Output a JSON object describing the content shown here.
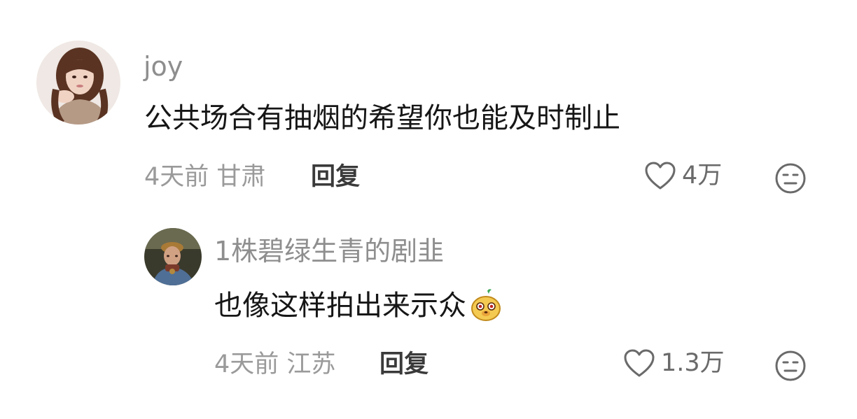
{
  "comments": [
    {
      "username": "joy",
      "text": "公共场合有抽烟的希望你也能及时制止",
      "time": "4天前",
      "location": "甘肃",
      "reply_label": "回复",
      "likes": "4万",
      "avatar_icon": "woman-portrait-avatar"
    }
  ],
  "replies": [
    {
      "username": "1株碧绿生青的剧韭",
      "text": "也像这样拍出来示众",
      "sticker_icon": "yellow-dog-emoji-sticker",
      "time": "4天前",
      "location": "江苏",
      "reply_label": "回复",
      "likes": "1.3万",
      "avatar_icon": "painting-portrait-avatar"
    }
  ],
  "icons": {
    "like": "heart-outline-icon",
    "dislike": "neutral-face-icon"
  },
  "colors": {
    "username": "#8e8e8e",
    "content": "#161616",
    "meta": "#9a9a9a",
    "reply": "#3a3a3a",
    "icon": "#6a6a6a"
  }
}
